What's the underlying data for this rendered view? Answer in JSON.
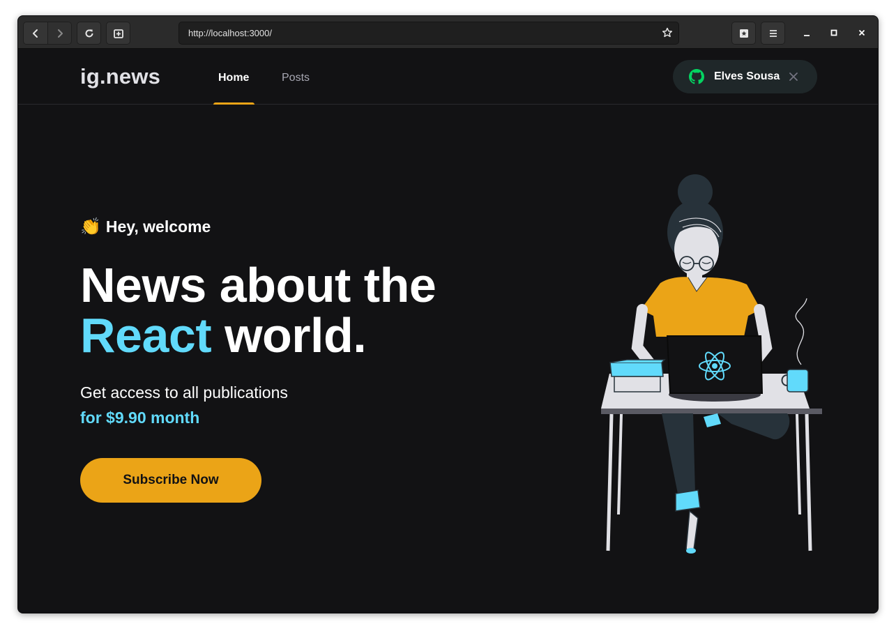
{
  "browser": {
    "url": "http://localhost:3000/"
  },
  "site": {
    "logo": "ig.news",
    "nav": [
      {
        "label": "Home",
        "active": true
      },
      {
        "label": "Posts",
        "active": false
      }
    ],
    "user": {
      "name": "Elves Sousa"
    }
  },
  "hero": {
    "greeting_emoji": "👏",
    "greeting": "Hey, welcome",
    "title_line1": "News about the",
    "title_accent": "React",
    "title_line2_rest": " world.",
    "subtitle": "Get access to all publications",
    "price": "for $9.90 month",
    "cta": "Subscribe Now"
  },
  "colors": {
    "background": "#121214",
    "accent_yellow": "#eba417",
    "react_cyan": "#61dafb",
    "github_green": "#04d361"
  },
  "icons": {
    "back": "chevron-left-icon",
    "forward": "chevron-right-icon",
    "reload": "reload-icon",
    "new_tab": "new-tab-icon",
    "bookmark": "star-icon",
    "library": "bookmarks-library-icon",
    "menu": "hamburger-menu-icon",
    "github": "github-icon",
    "sign_out": "close-icon"
  }
}
